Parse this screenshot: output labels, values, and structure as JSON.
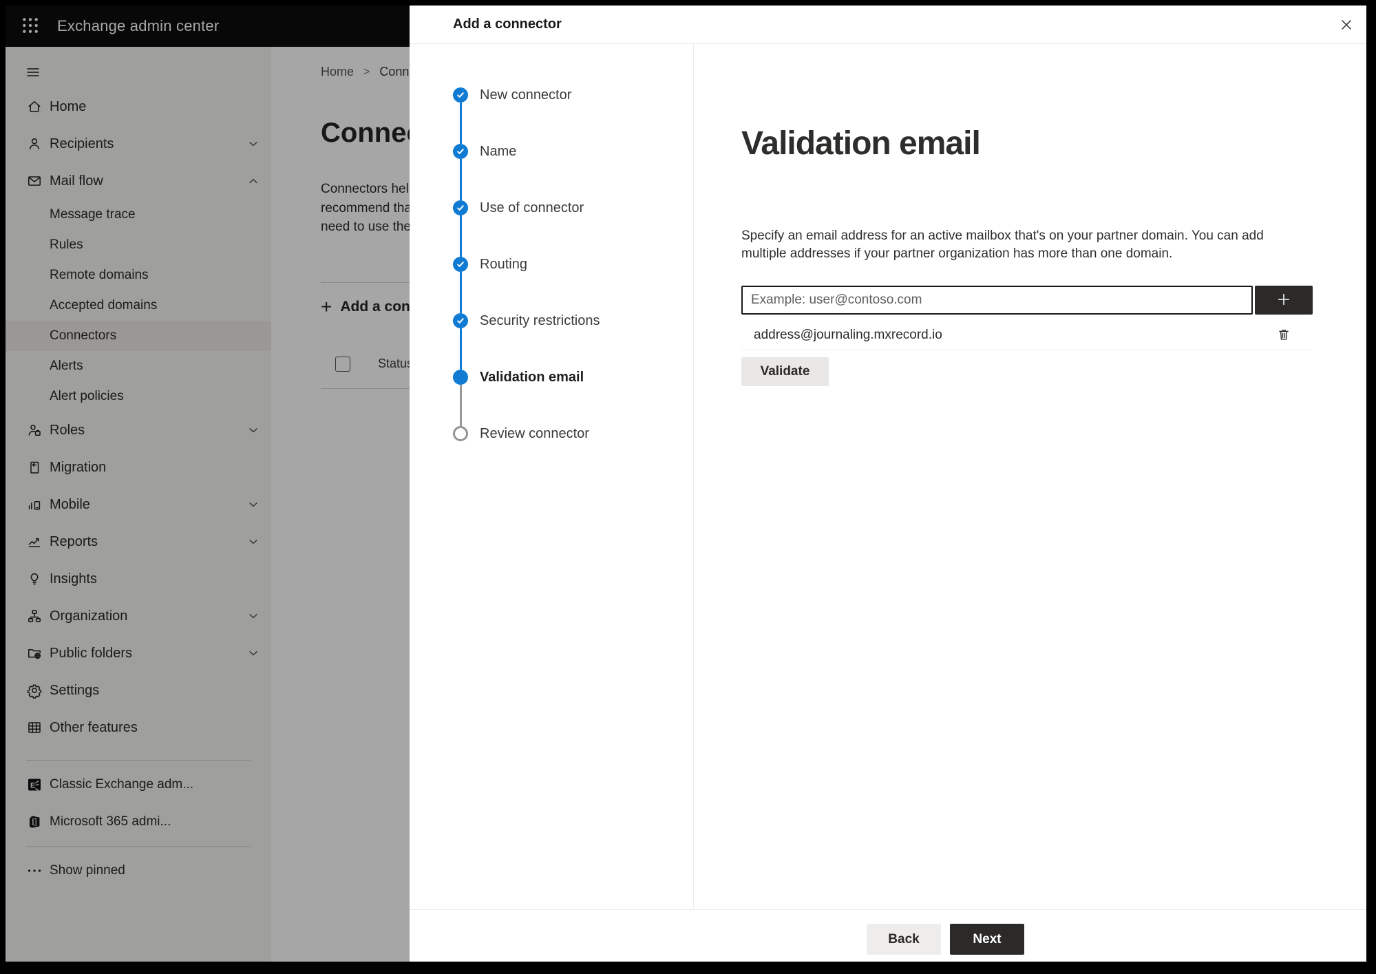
{
  "topbar": {
    "title": "Exchange admin center",
    "app_launcher_icon": "waffle-icon"
  },
  "sidebar": {
    "nav_toggle_icon": "hamburger-icon",
    "items": [
      {
        "label": "Home",
        "icon": "home-icon",
        "type": "top"
      },
      {
        "label": "Recipients",
        "icon": "recipients-icon",
        "type": "top",
        "chevron": "down"
      },
      {
        "label": "Mail flow",
        "icon": "mail-flow-icon",
        "type": "top",
        "chevron": "up"
      },
      {
        "label": "Message trace",
        "type": "sub"
      },
      {
        "label": "Rules",
        "type": "sub"
      },
      {
        "label": "Remote domains",
        "type": "sub"
      },
      {
        "label": "Accepted domains",
        "type": "sub"
      },
      {
        "label": "Connectors",
        "type": "sub",
        "selected": true
      },
      {
        "label": "Alerts",
        "type": "sub"
      },
      {
        "label": "Alert policies",
        "type": "sub"
      },
      {
        "label": "Roles",
        "icon": "roles-icon",
        "type": "top",
        "chevron": "down"
      },
      {
        "label": "Migration",
        "icon": "migration-icon",
        "type": "top"
      },
      {
        "label": "Mobile",
        "icon": "mobile-icon",
        "type": "top",
        "chevron": "down"
      },
      {
        "label": "Reports",
        "icon": "reports-icon",
        "type": "top",
        "chevron": "down"
      },
      {
        "label": "Insights",
        "icon": "insights-icon",
        "type": "top"
      },
      {
        "label": "Organization",
        "icon": "organization-icon",
        "type": "top",
        "chevron": "down"
      },
      {
        "label": "Public folders",
        "icon": "public-folders-icon",
        "type": "top",
        "chevron": "down"
      },
      {
        "label": "Settings",
        "icon": "settings-icon",
        "type": "top"
      },
      {
        "label": "Other features",
        "icon": "other-features-icon",
        "type": "top"
      }
    ],
    "footer_items": [
      {
        "label": "Classic Exchange adm...",
        "icon": "classic-exchange-icon"
      },
      {
        "label": "Microsoft 365 admi...",
        "icon": "microsoft-365-icon"
      }
    ],
    "pinned": {
      "label": "Show pinned",
      "icon": "ellipsis-icon"
    }
  },
  "page": {
    "breadcrumb": {
      "items": [
        "Home",
        "Conne"
      ],
      "separator": ">"
    },
    "title": "Connec",
    "description_lines": [
      "Connectors help",
      "recommend that",
      "need to use ther"
    ],
    "add_button_label": "Add a conn",
    "add_button_icon": "plus-icon",
    "table": {
      "status_header": "Status"
    }
  },
  "modal": {
    "title": "Add a connector",
    "close_icon": "close-icon",
    "steps": [
      {
        "label": "New connector",
        "state": "completed"
      },
      {
        "label": "Name",
        "state": "completed"
      },
      {
        "label": "Use of connector",
        "state": "completed"
      },
      {
        "label": "Routing",
        "state": "completed"
      },
      {
        "label": "Security restrictions",
        "state": "completed"
      },
      {
        "label": "Validation email",
        "state": "current"
      },
      {
        "label": "Review connector",
        "state": "upcoming"
      }
    ],
    "content": {
      "heading": "Validation email",
      "description": "Specify an email address for an active mailbox that's on your partner domain. You can add multiple addresses if your partner organization has more than one domain.",
      "email_input": {
        "placeholder": "Example: user@contoso.com",
        "value": ""
      },
      "add_address_icon": "plus-icon",
      "addresses": [
        "address@journaling.mxrecord.io"
      ],
      "delete_address_icon": "trash-icon",
      "validate_label": "Validate"
    },
    "footer": {
      "back_label": "Back",
      "next_label": "Next"
    }
  },
  "colors": {
    "accent": "#0f7bd3",
    "topbar_bg": "#0d0d0d",
    "dark_button": "#2b2a29",
    "step_upcoming_border": "#979593"
  }
}
